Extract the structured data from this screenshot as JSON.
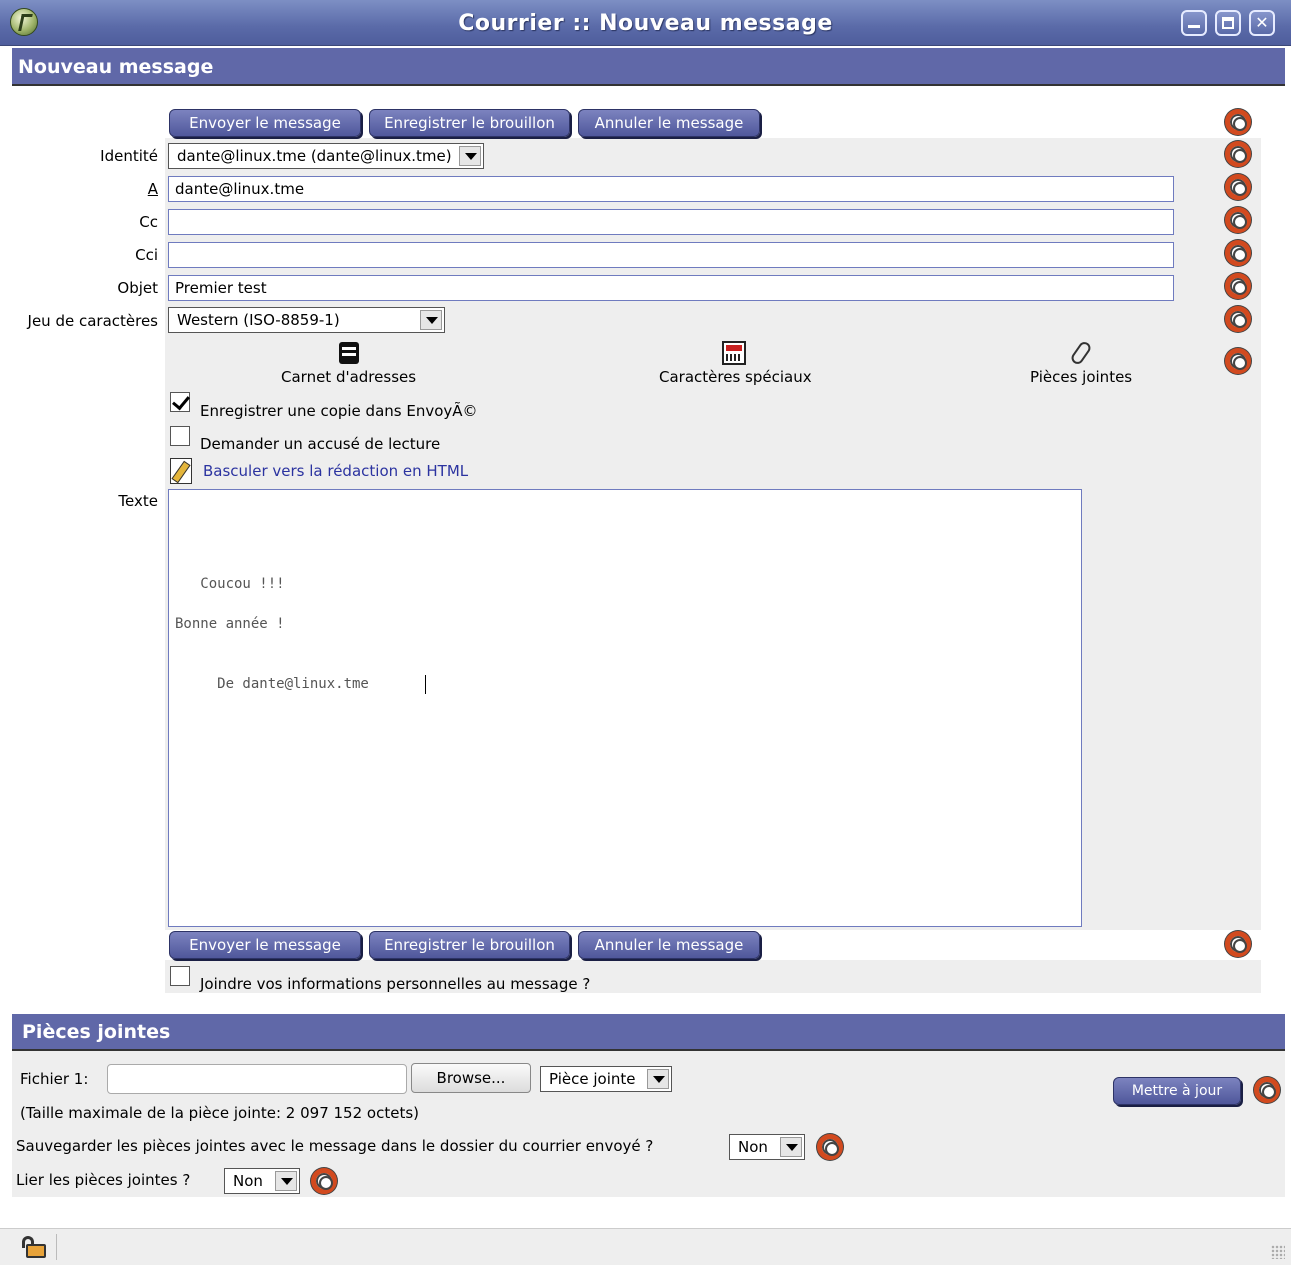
{
  "window": {
    "title": "Courrier :: Nouveau message"
  },
  "compose": {
    "header": "Nouveau message",
    "buttons": {
      "send": "Envoyer le message",
      "save_draft": "Enregistrer le brouillon",
      "cancel": "Annuler le message"
    },
    "fields": {
      "identity_label": "Identité",
      "identity_value": "dante@linux.tme (dante@linux.tme)",
      "to_label": "A",
      "to_value": "dante@linux.tme",
      "cc_label": "Cc",
      "cc_value": "",
      "bcc_label": "Cci",
      "bcc_value": "",
      "subject_label": "Objet",
      "subject_value": "Premier test",
      "charset_label": "Jeu de caractères",
      "charset_value": "Western (ISO-8859-1)"
    },
    "tools": {
      "address_book": "Carnet d'adresses",
      "special_chars": "Caractères spéciaux",
      "attachments": "Pièces jointes"
    },
    "options": {
      "save_copy": "Enregistrer une copie dans EnvoyÃ©",
      "save_copy_checked": true,
      "read_receipt": "Demander un accusé de lecture",
      "read_receipt_checked": false,
      "switch_html": "Basculer vers la rédaction en HTML"
    },
    "body": {
      "label": "Texte",
      "lines": [
        "   Coucou !!!",
        "Bonne année !",
        "     De dante@linux.tme"
      ]
    },
    "personal_info": "Joindre vos informations personnelles au message ?",
    "personal_info_checked": false
  },
  "attachments": {
    "header": "Pièces jointes",
    "file_label": "Fichier 1:",
    "file_value": "",
    "browse": "Browse...",
    "type_select": "Pièce jointe",
    "update_button": "Mettre à jour",
    "max_size": "(Taille maximale de la pièce jointe: 2 097 152 octets)",
    "save_with_message_label": "Sauvegarder les pièces jointes avec le message dans le dossier du courrier envoyé ?",
    "save_with_message_value": "Non",
    "link_label": "Lier les pièces jointes ?",
    "link_value": "Non"
  }
}
